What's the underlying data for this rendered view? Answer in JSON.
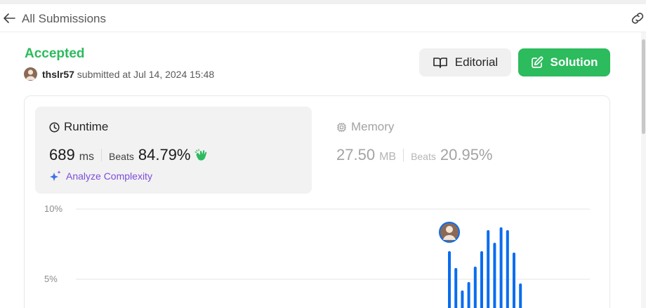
{
  "header": {
    "back_label": "All Submissions"
  },
  "submission": {
    "status": "Accepted",
    "user": "thslr57",
    "submitted_text": " submitted at Jul 14, 2024 15:48"
  },
  "buttons": {
    "editorial": "Editorial",
    "solution": "Solution"
  },
  "runtime": {
    "title": "Runtime",
    "value": "689",
    "unit": "ms",
    "beats_label": "Beats",
    "beats_value": "84.79%",
    "analyze_label": "Analyze Complexity"
  },
  "memory": {
    "title": "Memory",
    "value": "27.50",
    "unit": "MB",
    "beats_label": "Beats",
    "beats_value": "20.95%"
  },
  "colors": {
    "accepted": "#2cbb5d",
    "bar": "#0a6cf0",
    "analyze": "#7c4ddc"
  },
  "chart_data": {
    "type": "bar",
    "y_ticks": [
      "10%",
      "5%"
    ],
    "y_tick_values": [
      10,
      5
    ],
    "ylim": [
      4,
      10.3
    ],
    "values": [
      7.0,
      5.8,
      4.2,
      4.8,
      5.9,
      7.0,
      8.5,
      7.6,
      8.7,
      8.5,
      6.9,
      4.7
    ],
    "highlight_index": 0
  }
}
